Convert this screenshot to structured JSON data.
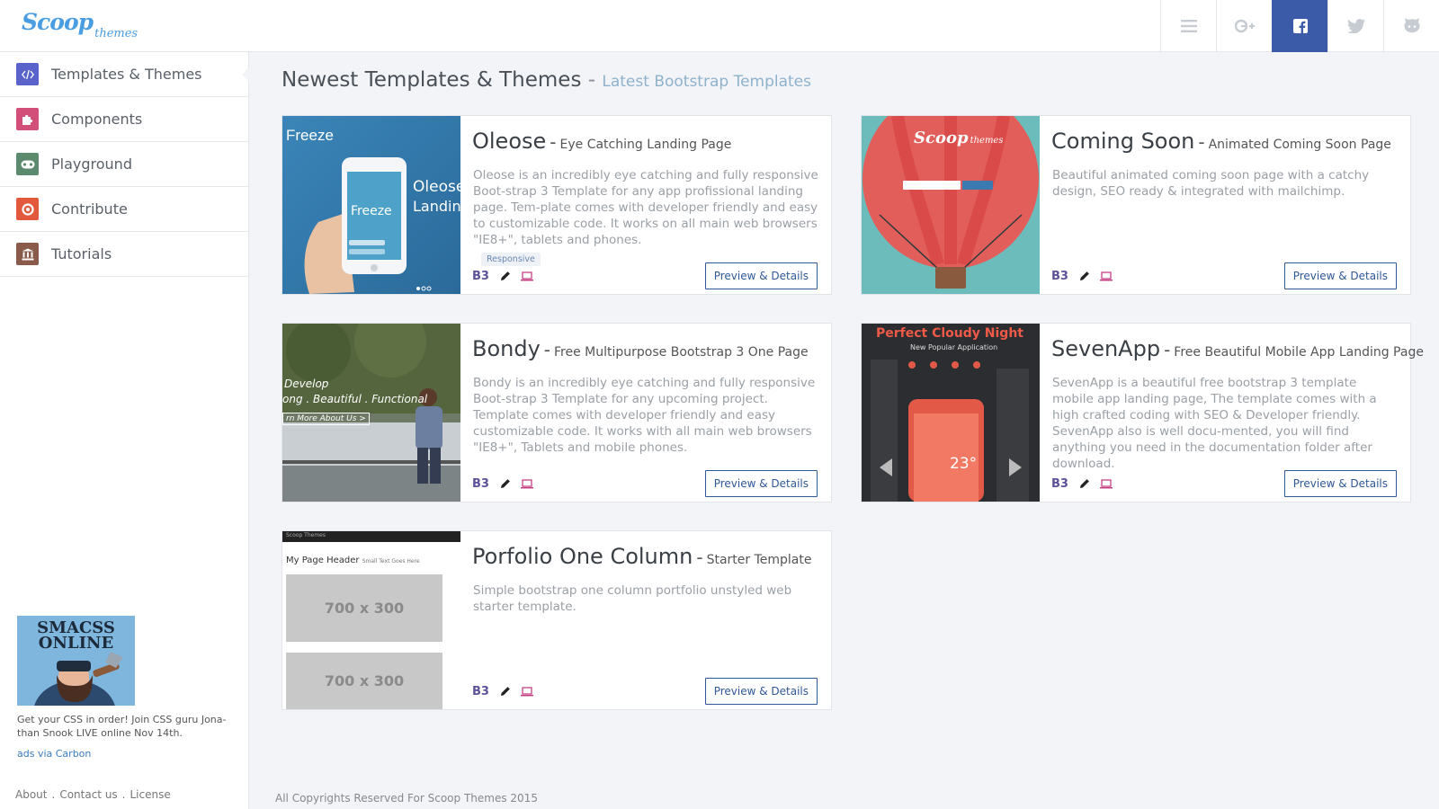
{
  "logo": {
    "big": "Scoop",
    "small": "themes"
  },
  "topbar_icons": [
    "menu-icon",
    "google-plus-icon",
    "facebook-icon",
    "twitter-icon",
    "github-icon"
  ],
  "sidebar": {
    "items": [
      {
        "label": "Templates & Themes",
        "icon": "code-icon",
        "color": "#5a63c9"
      },
      {
        "label": "Components",
        "icon": "puzzle-icon",
        "color": "#d24f7a"
      },
      {
        "label": "Playground",
        "icon": "gamepad-icon",
        "color": "#5c8a6e"
      },
      {
        "label": "Contribute",
        "icon": "lifebuoy-icon",
        "color": "#e2593e"
      },
      {
        "label": "Tutorials",
        "icon": "bank-icon",
        "color": "#8a5a4a"
      }
    ],
    "ad": {
      "image_title": "SMACSS ONLINE",
      "text": "Get your CSS in order! Join CSS guru Jona-than Snook LIVE online Nov 14th.",
      "via": "ads via Carbon"
    },
    "footer_links": [
      "About",
      "Contact us",
      "License"
    ]
  },
  "heading": {
    "title": "Newest Templates & Themes",
    "dash": "-",
    "subtitle": "Latest Bootstrap Templates"
  },
  "cards": [
    {
      "title": "Oleose",
      "subtitle": "Eye Catching Landing Page",
      "description": "Oleose is an incredibly eye catching and fully responsive Boot-strap 3 Template for any app profissional landing page. Tem-plate comes with developer friendly and easy to customizable code. It works on all main web browsers \"IE8+\", tablets and phones.",
      "tag": "Responsive",
      "b3": "B3",
      "button": "Preview & Details",
      "thumb": {
        "brand": "Freeze",
        "headline": "Oleose",
        "sub": "Landing"
      }
    },
    {
      "title": "Coming Soon",
      "subtitle": "Animated Coming Soon Page",
      "description": "Beautiful animated coming soon page with a catchy design, SEO ready & integrated with mailchimp.",
      "b3": "B3",
      "button": "Preview & Details",
      "thumb": {
        "brand": "Scoop",
        "brand_small": "themes"
      }
    },
    {
      "title": "Bondy",
      "subtitle": "Free Multipurpose Bootstrap 3 One Page",
      "description": "Bondy is an incredibly eye catching and fully responsive Boot-strap 3 Template for any upcoming project. Template comes with developer friendly and easy customizable code. It works with all main web browsers \"IE8+\", Tablets and mobile phones.",
      "b3": "B3",
      "button": "Preview & Details",
      "thumb": {
        "line1": "Develop",
        "line2": "ong . Beautiful . Functional",
        "link": "rn More About Us >"
      }
    },
    {
      "title": "SevenApp",
      "subtitle": "Free Beautiful Mobile App Landing Page",
      "description": "SevenApp is a beautiful free bootstrap 3 template mobile app landing page, The template comes with a high crafted coding with SEO & Developer friendly. SevenApp also is well docu-mented, you will find anything you need in the documentation folder after download.",
      "b3": "B3",
      "button": "Preview & Details",
      "thumb": {
        "headline": "Perfect Cloudy Night",
        "sub": "New Popular Application",
        "temp": "23°"
      }
    },
    {
      "title": "Porfolio One Column",
      "subtitle": "Starter Template",
      "description": "Simple bootstrap one column portfolio unstyled web starter template.",
      "b3": "B3",
      "button": "Preview & Details",
      "thumb": {
        "nav": "Scoop Themes",
        "header": "My Page Header",
        "header_small": "Small Text Goes Here",
        "placeholder1": "700 x 300",
        "placeholder2": "700 x 300"
      }
    }
  ],
  "footer": "All Copyrights Reserved For Scoop Themes 2015"
}
